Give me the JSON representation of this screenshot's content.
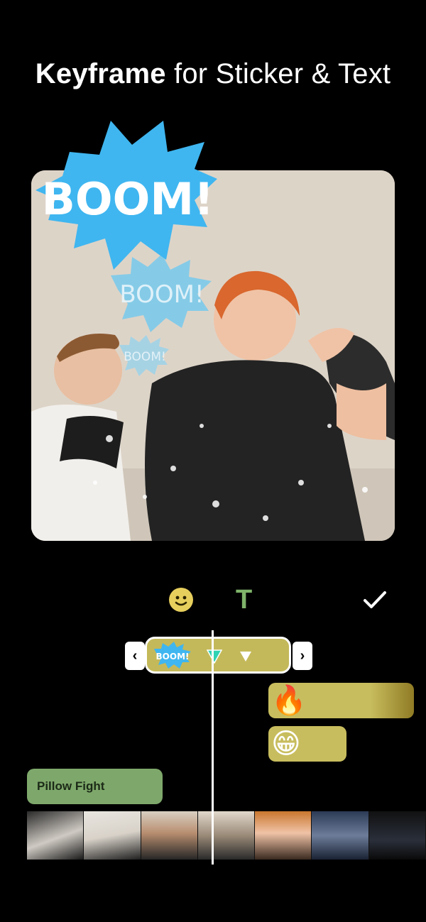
{
  "header": {
    "title_bold": "Keyframe",
    "title_rest": " for Sticker & Text"
  },
  "preview": {
    "sticker_texts": [
      "BOOM!",
      "BOOM!",
      "BOOM!"
    ]
  },
  "toolbar": {
    "items": [
      {
        "icon": "smiley-icon",
        "label": ""
      },
      {
        "icon": "text-icon",
        "label": "T"
      },
      {
        "icon": "checkmark-icon",
        "label": ""
      }
    ]
  },
  "timeline": {
    "selected_clip": {
      "sticker_text": "BOOM!",
      "left_handle": "‹",
      "right_handle": "›"
    },
    "emoji_clips": [
      {
        "icon": "fire-emoji-icon",
        "glyph": "🔥"
      },
      {
        "icon": "grin-emoji-icon",
        "glyph": "😁"
      }
    ],
    "text_clip": {
      "label": "Pillow Fight"
    },
    "filmstrip_frames": 7
  },
  "colors": {
    "background": "#000000",
    "sticker_clip": "#c4b95a",
    "text_clip": "#7ea86b",
    "sticker_blue": "#3fb6f0",
    "keyframe_teal": "#2fd3b3"
  }
}
